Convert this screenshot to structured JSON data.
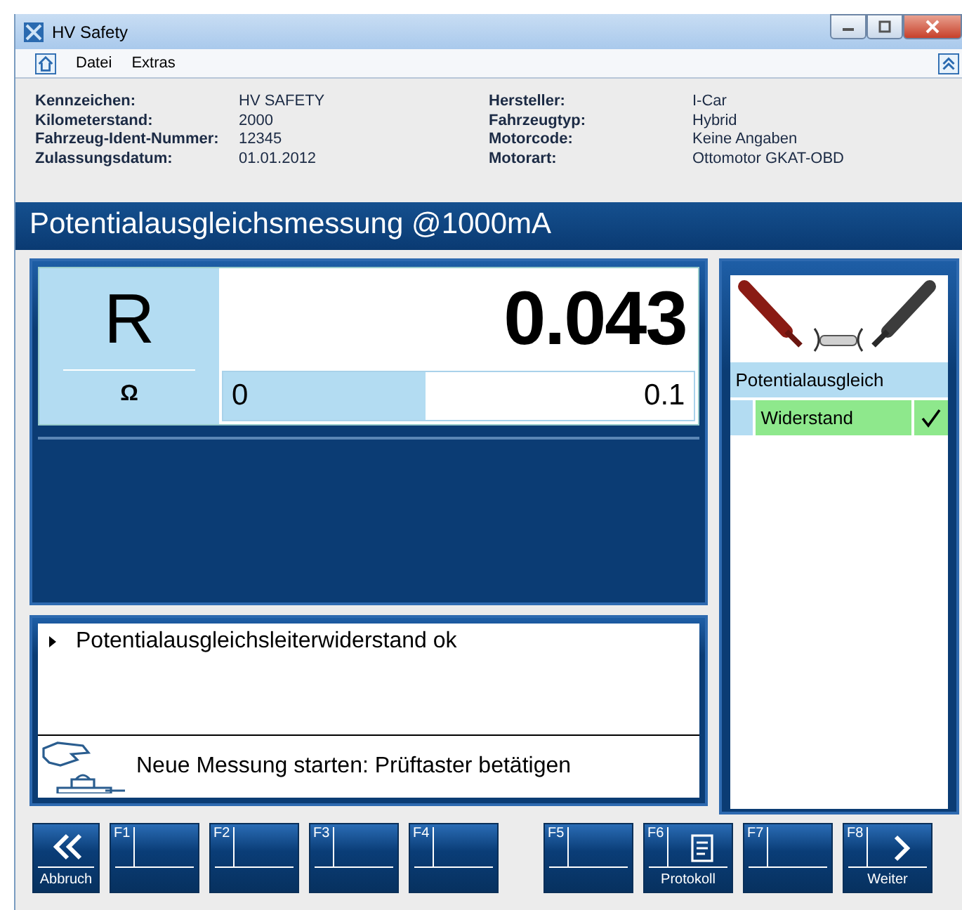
{
  "window": {
    "title": "HV Safety"
  },
  "menu": [
    "Datei",
    "Extras"
  ],
  "vehicle_info": [
    {
      "label": "Kennzeichen:",
      "value": "HV SAFETY"
    },
    {
      "label": "Kilometerstand:",
      "value": "2000"
    },
    {
      "label": "Fahrzeug-Ident-Nummer:",
      "value": "12345"
    },
    {
      "label": "Zulassungsdatum:",
      "value": "01.01.2012"
    },
    {
      "label": "Hersteller:",
      "value": "I-Car"
    },
    {
      "label": "Fahrzeugtyp:",
      "value": "Hybrid"
    },
    {
      "label": "Motorcode:",
      "value": "Keine Angaben"
    },
    {
      "label": "Motorart:",
      "value": "Ottomotor GKAT-OBD"
    }
  ],
  "heading": "Potentialausgleichsmessung @1000mA",
  "measurement": {
    "symbol": "R",
    "unit": "Ω",
    "value": "0.043",
    "scale_min": "0",
    "scale_max": "0.1",
    "level": 0.43
  },
  "steps": {
    "group": "Potentialausgleich",
    "items": [
      {
        "label": "Widerstand",
        "checked": true
      }
    ]
  },
  "messages": [
    "Potentialausgleichsleiterwiderstand ok"
  ],
  "instruction": "Neue Messung starten: Prüftaster betätigen",
  "buttons": [
    {
      "kind": "back",
      "label": "Abbruch"
    },
    {
      "kind": "fkey",
      "key": "F1"
    },
    {
      "kind": "fkey",
      "key": "F2"
    },
    {
      "kind": "fkey",
      "key": "F3"
    },
    {
      "kind": "fkey",
      "key": "F4"
    },
    {
      "kind": "gap"
    },
    {
      "kind": "fkey",
      "key": "F5"
    },
    {
      "kind": "document",
      "key": "F6",
      "label": "Protokoll"
    },
    {
      "kind": "fkey",
      "key": "F7"
    },
    {
      "kind": "next",
      "key": "F8",
      "label": "Weiter"
    }
  ]
}
